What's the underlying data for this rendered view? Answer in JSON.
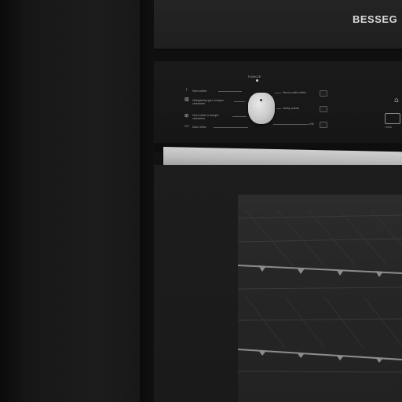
{
  "brand": {
    "logo_text": "BESSEG"
  },
  "control_panel": {
    "knob_label": "FUNKCE",
    "left_functions": [
      {
        "icon": "arrow-up-icon",
        "label": "Horní ohřev"
      },
      {
        "icon": "grill-icon",
        "label": "Velkoplošný gril s horkým vzduchem"
      },
      {
        "icon": "fan-grill-icon",
        "label": "Horní ohřev s horkým vzduchem"
      },
      {
        "icon": "bottom-heat-icon",
        "label": "Dolní ohřev"
      }
    ],
    "right_functions": [
      {
        "label": "Horní a dolní ohřev"
      },
      {
        "label": "Horký vzduch"
      },
      {
        "label": "Gril"
      }
    ],
    "timer_label": "TIMER"
  },
  "colors": {
    "body": "#1a1a1a",
    "handle": "#c4c4c4",
    "knob": "#d6d6d6",
    "logo": "#d9d9d9"
  }
}
